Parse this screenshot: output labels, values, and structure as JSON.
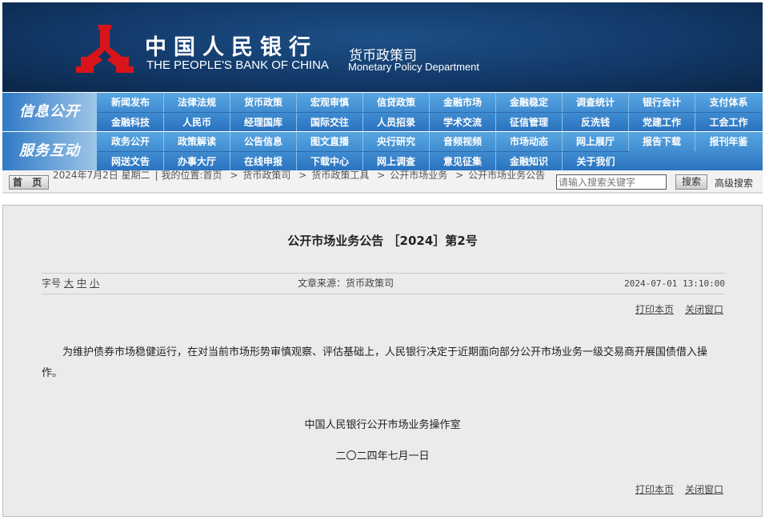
{
  "header": {
    "bank_name_cn": "中国人民银行",
    "bank_name_en": "THE PEOPLE'S BANK OF CHINA",
    "dept_cn": "货币政策司",
    "dept_en": "Monetary Policy Department"
  },
  "nav": [
    {
      "label": "信息公开",
      "rows": [
        [
          "新闻发布",
          "法律法规",
          "货币政策",
          "宏观审慎",
          "信贷政策",
          "金融市场",
          "金融稳定",
          "调查统计",
          "银行会计",
          "支付体系"
        ],
        [
          "金融科技",
          "人民币",
          "经理国库",
          "国际交往",
          "人员招录",
          "学术交流",
          "征信管理",
          "反洗钱",
          "党建工作",
          "工会工作"
        ]
      ]
    },
    {
      "label": "服务互动",
      "rows": [
        [
          "政务公开",
          "政策解读",
          "公告信息",
          "图文直播",
          "央行研究",
          "音频视频",
          "市场动态",
          "网上展厅",
          "报告下载",
          "报刊年鉴"
        ],
        [
          "网送文告",
          "办事大厅",
          "在线申报",
          "下载中心",
          "网上调查",
          "意见征集",
          "金融知识",
          "关于我们"
        ]
      ]
    }
  ],
  "breadcrumb": {
    "home_button": "首 页",
    "date": "2024年7月2日 星期二",
    "location_label": "| 我的位置:首页",
    "items": [
      "货币政策司",
      "货币政策工具",
      "公开市场业务",
      "公开市场业务公告"
    ],
    "separator": ">"
  },
  "search": {
    "placeholder": "请输入搜索关键字",
    "button": "搜索",
    "advanced": "高级搜索"
  },
  "article": {
    "title": "公开市场业务公告 ［2024］第2号",
    "font_size_label": "字号",
    "font_sizes": [
      "大",
      "中",
      "小"
    ],
    "source": "文章来源：货币政策司",
    "datetime": "2024-07-01 13:10:00",
    "print": "打印本页",
    "close": "关闭窗口",
    "body": "为维护债券市场稳健运行，在对当前市场形势审慎观察、评估基础上，人民银行决定于近期面向部分公开市场业务一级交易商开展国债借入操作。",
    "signer": "中国人民银行公开市场业务操作室",
    "sign_date": "二〇二四年七月一日"
  }
}
